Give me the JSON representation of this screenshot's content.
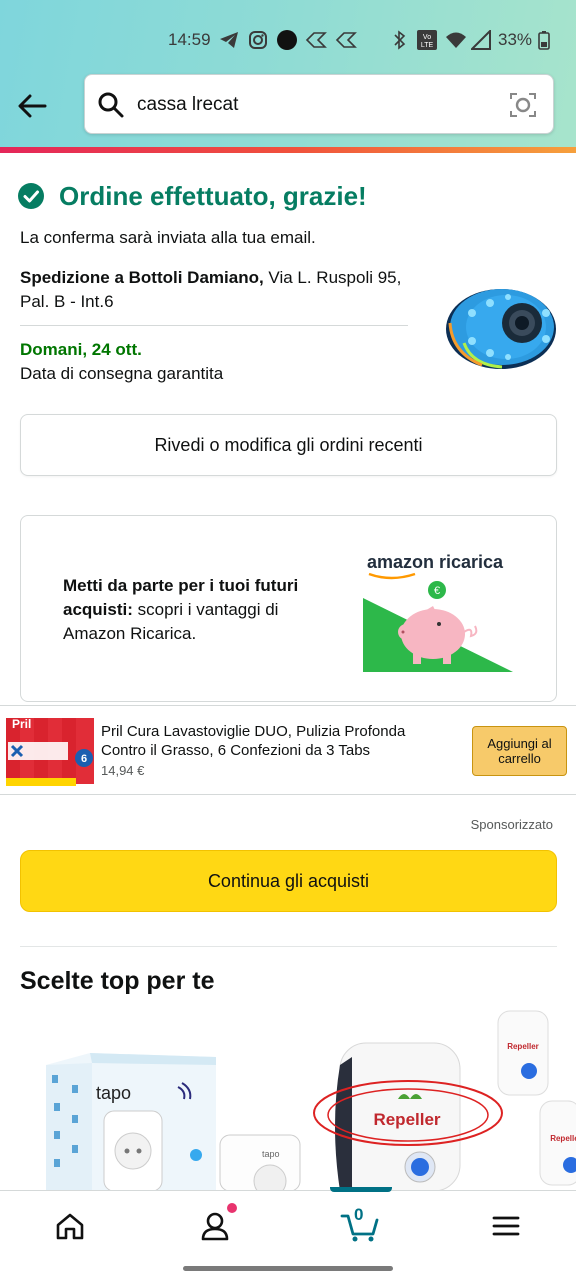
{
  "status_bar": {
    "time": "14:59",
    "battery": "33%",
    "icons": [
      "telegram-icon",
      "instagram-icon",
      "circle-icon",
      "diamond-icon",
      "diamond-icon",
      "bluetooth-icon",
      "volte-icon",
      "wifi-icon",
      "signal-icon",
      "battery-icon"
    ]
  },
  "search": {
    "query": "cassa lrecat"
  },
  "confirmation": {
    "title": "Ordine effettuato, grazie!",
    "subtitle": "La conferma sarà inviata alla tua email.",
    "ship_label": "Spedizione a Bottoli Damiano,",
    "ship_address": " Via L. Ruspoli 95, Pal. B - Int.6",
    "delivery_date": "Domani, 24 ott.",
    "delivery_note": "Data di consegna garantita",
    "review_button": "Rivedi o modifica gli ordini recenti"
  },
  "ricarica": {
    "bold_text": "Metti da parte per i tuoi futuri acquisti:",
    "text": " scopri i vantaggi di Amazon Ricarica.",
    "logo_text": "amazon ricarica"
  },
  "sponsored_product": {
    "title": "Pril Cura Lavastoviglie DUO, Pulizia Profonda Contro il Grasso, 6 Confezioni da 3 Tabs",
    "price": "14,94 €",
    "add_to_cart": "Aggiungi al carrello",
    "image_text": "Pril"
  },
  "sponsored_label": "Sponsorizzato",
  "continue_button": "Continua gli acquisti",
  "top_picks": {
    "title": "Scelte top per te",
    "items": [
      {
        "brand": "tapo"
      },
      {
        "brand": "Repeller"
      }
    ]
  },
  "bottom_nav": {
    "cart_count": "0",
    "items": [
      "home-icon",
      "account-icon",
      "cart-icon",
      "menu-icon"
    ]
  },
  "colors": {
    "success_green": "#067d62",
    "delivery_green": "#007600",
    "primary_button": "#ffd814",
    "cart_button": "#f7ca6a",
    "nav_accent": "#007185"
  }
}
